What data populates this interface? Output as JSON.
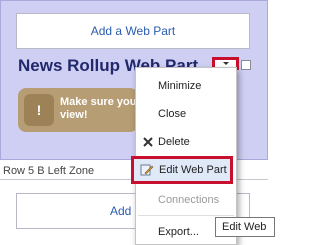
{
  "zone_top": {
    "add_web_part_label": "Add a Web Part"
  },
  "web_part": {
    "title": "News Rollup Web Part",
    "warning_text": "Make sure you view!"
  },
  "zone_bottom": {
    "label": "Row 5 B Left Zone",
    "add_web_part_label": "Add a W"
  },
  "context_menu": {
    "items": [
      {
        "label": "Minimize",
        "enabled": true,
        "icon": ""
      },
      {
        "label": "Close",
        "enabled": true,
        "icon": ""
      },
      {
        "label": "Delete",
        "enabled": true,
        "icon": "delete-x-icon"
      },
      {
        "label": "Edit Web Part",
        "enabled": true,
        "icon": "edit-pencil-icon",
        "highlighted": true
      },
      {
        "label": "Connections",
        "enabled": false,
        "icon": ""
      },
      {
        "label": "Export...",
        "enabled": true,
        "icon": ""
      }
    ]
  },
  "tooltip": {
    "text": "Edit Web"
  },
  "colors": {
    "zone_background": "#cfcff4",
    "title_color": "#22296a",
    "warning_background": "#b79d73",
    "highlight_red": "#c8102e",
    "link_blue": "#2a5db0"
  }
}
